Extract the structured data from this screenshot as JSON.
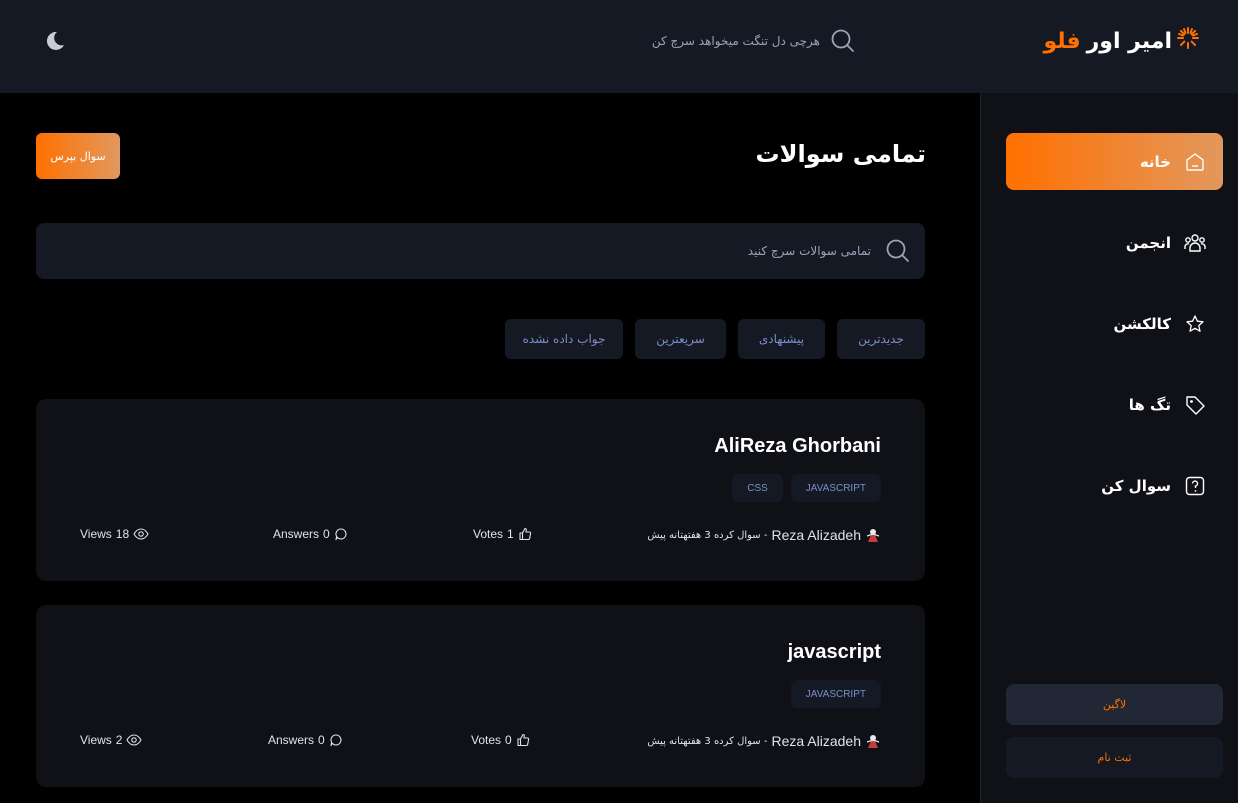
{
  "header": {
    "logo_word1": "امیر اور",
    "logo_word2": "فلو",
    "search_placeholder": "هرچی دل تنگت میخواهد سرچ کن"
  },
  "sidebar": {
    "items": [
      {
        "label": "خانه",
        "icon": "home-icon",
        "active": true
      },
      {
        "label": "انجمن",
        "icon": "community-icon",
        "active": false
      },
      {
        "label": "کالکشن",
        "icon": "star-icon",
        "active": false
      },
      {
        "label": "تگ ها",
        "icon": "tag-icon",
        "active": false
      },
      {
        "label": "سوال کن",
        "icon": "question-icon",
        "active": false
      }
    ],
    "login_label": "لاگین",
    "signup_label": "ثبت نام"
  },
  "main": {
    "title": "تمامی سوالات",
    "ask_button": "سوال بپرس",
    "search_placeholder": "تمامی سوالات سرچ کنید",
    "filters": [
      "جدیدترین",
      "پیشنهادی",
      "سریعترین",
      "جواب داده نشده"
    ]
  },
  "questions": [
    {
      "title": "AliReza Ghorbani",
      "tags": [
        "JAVASCRIPT",
        "CSS"
      ],
      "author": "Reza Alizadeh",
      "asked": "- سوال کرده 3 هفتهتانه پیش",
      "votes": "1",
      "votes_label": "Votes",
      "answers": "0",
      "answers_label": "Answers",
      "views": "18",
      "views_label": "Views"
    },
    {
      "title": "javascript",
      "tags": [
        "JAVASCRIPT"
      ],
      "author": "Reza Alizadeh",
      "asked": "- سوال کرده 3 هفتهتانه پیش",
      "votes": "0",
      "votes_label": "Votes",
      "answers": "0",
      "answers_label": "Answers",
      "views": "2",
      "views_label": "Views"
    }
  ],
  "colors": {
    "accent": "#ff7000",
    "accent_light": "#e2985e",
    "panel": "#151923",
    "tag_text": "#7b8ec8"
  }
}
